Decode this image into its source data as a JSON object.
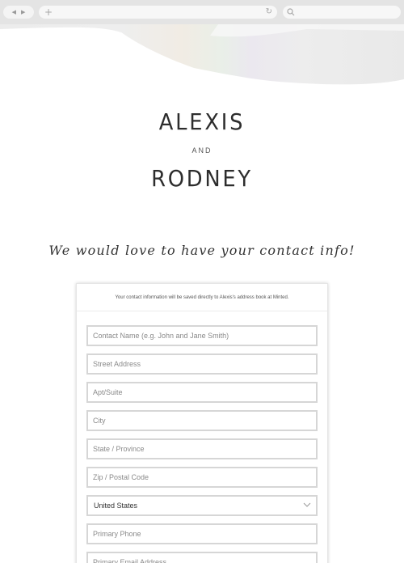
{
  "browser": {
    "back_icon": "◀",
    "forward_icon": "▶",
    "new_tab_icon": "+",
    "reload_icon": "↻"
  },
  "header": {
    "name_one": "ALEXIS",
    "conjunction": "AND",
    "name_two": "RODNEY"
  },
  "tagline": "We would love to have your contact info!",
  "form": {
    "note": "Your contact information will be saved directly to Alexis's address book at Minted.",
    "contact_name_placeholder": "Contact Name (e.g. John and Jane Smith)",
    "street_placeholder": "Street Address",
    "apt_placeholder": "Apt/Suite",
    "city_placeholder": "City",
    "state_placeholder": "State / Province",
    "zip_placeholder": "Zip / Postal Code",
    "country_value": "United States",
    "phone_placeholder": "Primary Phone",
    "email_placeholder": "Primary Email Address"
  },
  "colors": {
    "chrome_bg": "#e4e4e4",
    "page_bg": "#ffffff",
    "field_border": "#d6d6d6",
    "text": "#2d2d2d"
  }
}
